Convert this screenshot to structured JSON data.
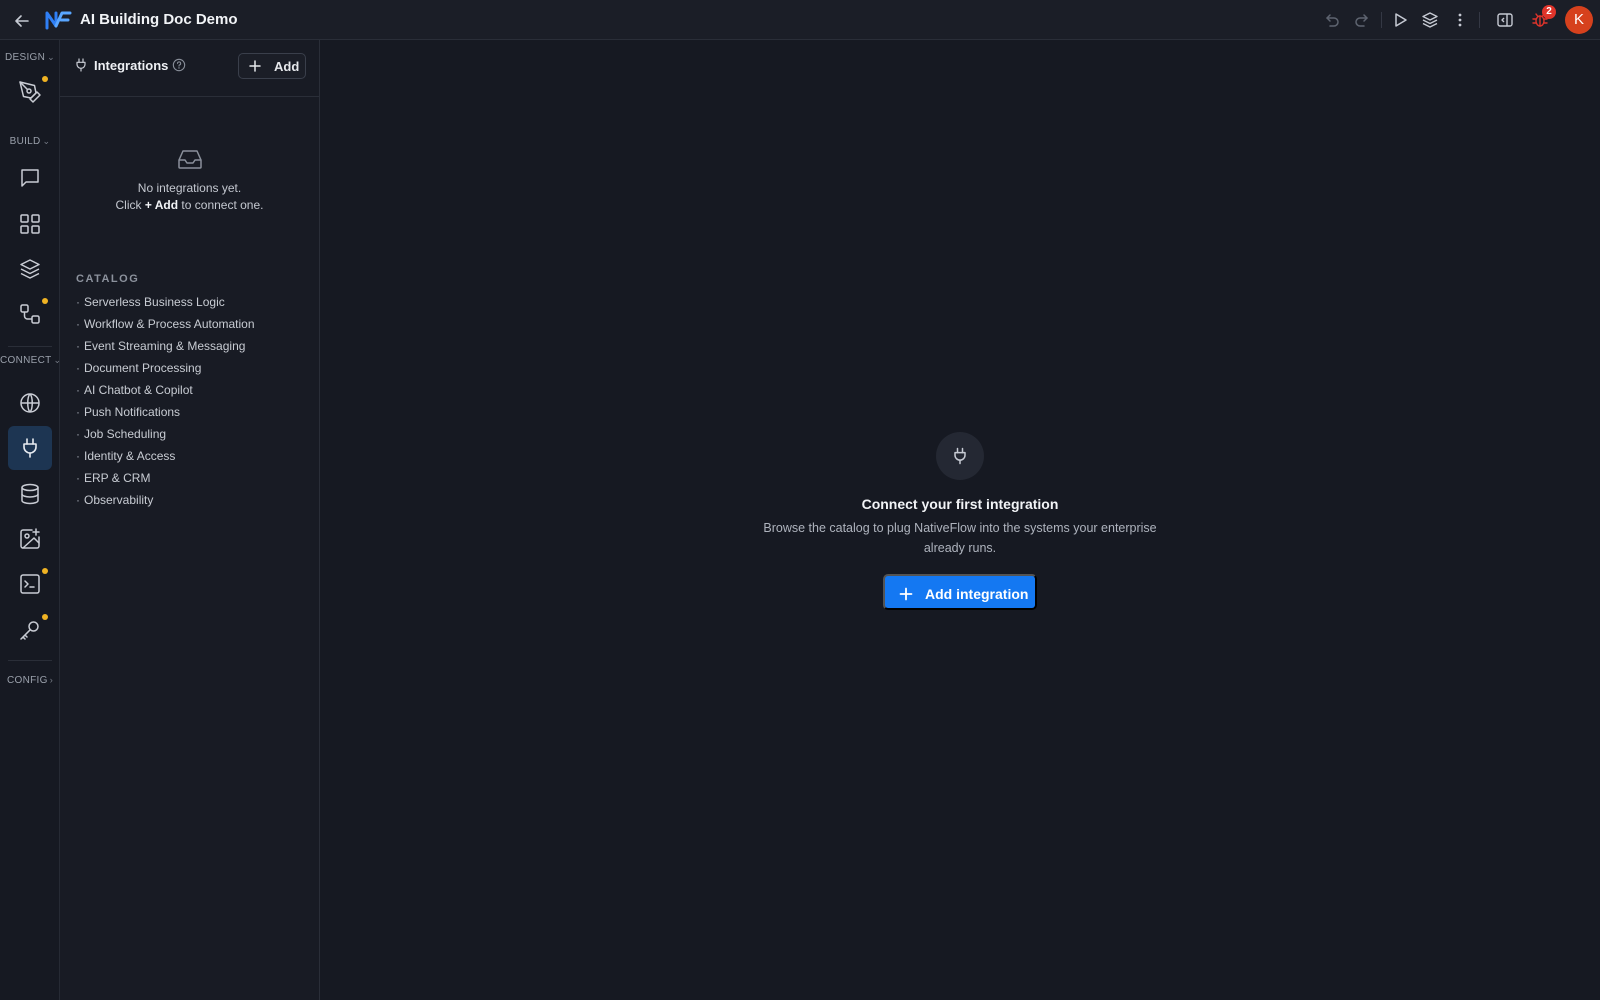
{
  "app": {
    "title": "AI Building Doc Demo",
    "notification_count": "2",
    "user_initial": "K"
  },
  "topbar": {
    "icons": [
      "back-arrow-icon",
      "logo",
      "undo-icon",
      "redo-icon",
      "play-icon",
      "layers-icon",
      "more-vertical-icon",
      "panel-toggle-icon",
      "bug-icon"
    ]
  },
  "rail": {
    "sections": {
      "design": "DESIGN",
      "build": "BUILD",
      "connect": "CONNECT",
      "config": "CONFIG"
    },
    "items": [
      {
        "icon": "pen-tool-icon",
        "section": "design",
        "dot": true
      },
      {
        "icon": "chat-icon",
        "section": "build",
        "dot": false
      },
      {
        "icon": "grid-icon",
        "section": "build",
        "dot": false
      },
      {
        "icon": "layers-icon",
        "section": "build",
        "dot": false
      },
      {
        "icon": "workflow-icon",
        "section": "build",
        "dot": true
      },
      {
        "icon": "globe-icon",
        "section": "connect",
        "dot": false
      },
      {
        "icon": "plug-icon",
        "section": "connect",
        "dot": false,
        "active": true
      },
      {
        "icon": "database-icon",
        "section": "connect",
        "dot": false
      },
      {
        "icon": "image-plus-icon",
        "section": "connect",
        "dot": false
      },
      {
        "icon": "terminal-icon",
        "section": "connect",
        "dot": true
      },
      {
        "icon": "key-icon",
        "section": "connect",
        "dot": true
      }
    ]
  },
  "panel": {
    "title": "Integrations",
    "add_label": "Add",
    "empty": {
      "line1": "No integrations yet.",
      "click": "Click",
      "add_text": "+ Add",
      "rest": "to connect one."
    },
    "catalog_title": "CATALOG",
    "catalog": [
      "Serverless Business Logic",
      "Workflow & Process Automation",
      "Event Streaming & Messaging",
      "Document Processing",
      "AI Chatbot & Copilot",
      "Push Notifications",
      "Job Scheduling",
      "Identity & Access",
      "ERP & CRM",
      "Observability"
    ]
  },
  "main": {
    "title": "Connect your first integration",
    "description": "Browse the catalog to plug NativeFlow into the systems your enterprise already runs.",
    "cta_label": "Add integration"
  },
  "colors": {
    "accent": "#1478f2",
    "active_rail_bg": "#1d3552",
    "dot": "#f0b323",
    "badge": "#e0342b",
    "avatar": "#d6411d",
    "bug_icon": "#e0342b"
  }
}
